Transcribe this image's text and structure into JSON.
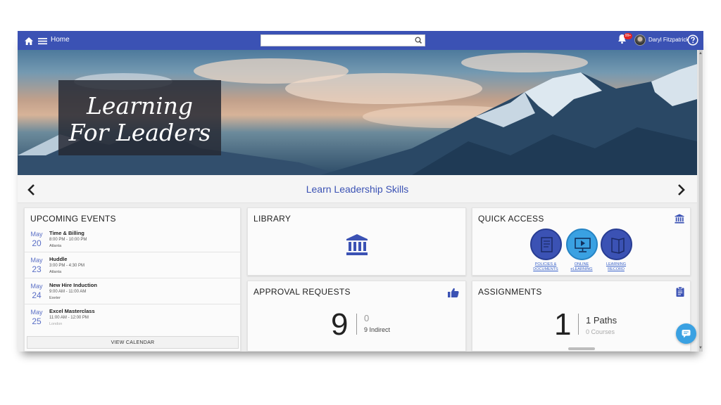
{
  "topbar": {
    "home_label": "Home",
    "search": {
      "value": "",
      "placeholder": ""
    },
    "notification_badge": "99+",
    "user_name": "Daryl Fitzpatrick",
    "bar_color": "#3b52b4"
  },
  "hero": {
    "title_line1": "Learning",
    "title_line2": "For Leaders"
  },
  "carousel": {
    "caption": "Learn Leadership Skills"
  },
  "events": {
    "title": "UPCOMING EVENTS",
    "items": [
      {
        "month": "May",
        "day": "20",
        "name": "Time & Billing",
        "time": "8:00 PM - 10:00 PM",
        "location": "Atlanta"
      },
      {
        "month": "May",
        "day": "23",
        "name": "Huddle",
        "time": "3:00 PM - 4:30 PM",
        "location": "Atlanta"
      },
      {
        "month": "May",
        "day": "24",
        "name": "New Hire Induction",
        "time": "9:00 AM - 11:00 AM",
        "location": "Exeter"
      },
      {
        "month": "May",
        "day": "25",
        "name": "Excel Masterclass",
        "time": "11:00 AM - 12:00 PM",
        "location": "London"
      }
    ],
    "view_calendar": "VIEW CALENDAR"
  },
  "library": {
    "title": "LIBRARY"
  },
  "approvals": {
    "title": "APPROVAL REQUESTS",
    "count": "9",
    "indirect_count": "0",
    "indirect_label": "9 Indirect"
  },
  "quick_access": {
    "title": "QUICK ACCESS",
    "items": [
      {
        "label_line1": "POLICIES &",
        "label_line2": "DOCUMENTS"
      },
      {
        "label_line1": "ONLINE",
        "label_line2": "eLEARNING"
      },
      {
        "label_line1": "LEARNING",
        "label_line2": "RECORD"
      }
    ]
  },
  "assignments": {
    "title": "ASSIGNMENTS",
    "count": "1",
    "paths_label": "1 Paths",
    "courses_label": "0 Courses"
  },
  "icons": {
    "home": "home-icon",
    "menu": "hamburger-menu-icon",
    "search": "magnifier-icon",
    "bell": "bell-icon",
    "help": "question-circle-icon",
    "library": "bank-building-icon",
    "approvals": "thumbs-up-icon",
    "quick_access": "bank-building-icon",
    "assignments": "clipboard-icon",
    "chat": "chat-bubble-icon"
  },
  "colors": {
    "accent": "#3b52b4",
    "light_accent": "#3aa1e2",
    "badge": "#e02424"
  }
}
